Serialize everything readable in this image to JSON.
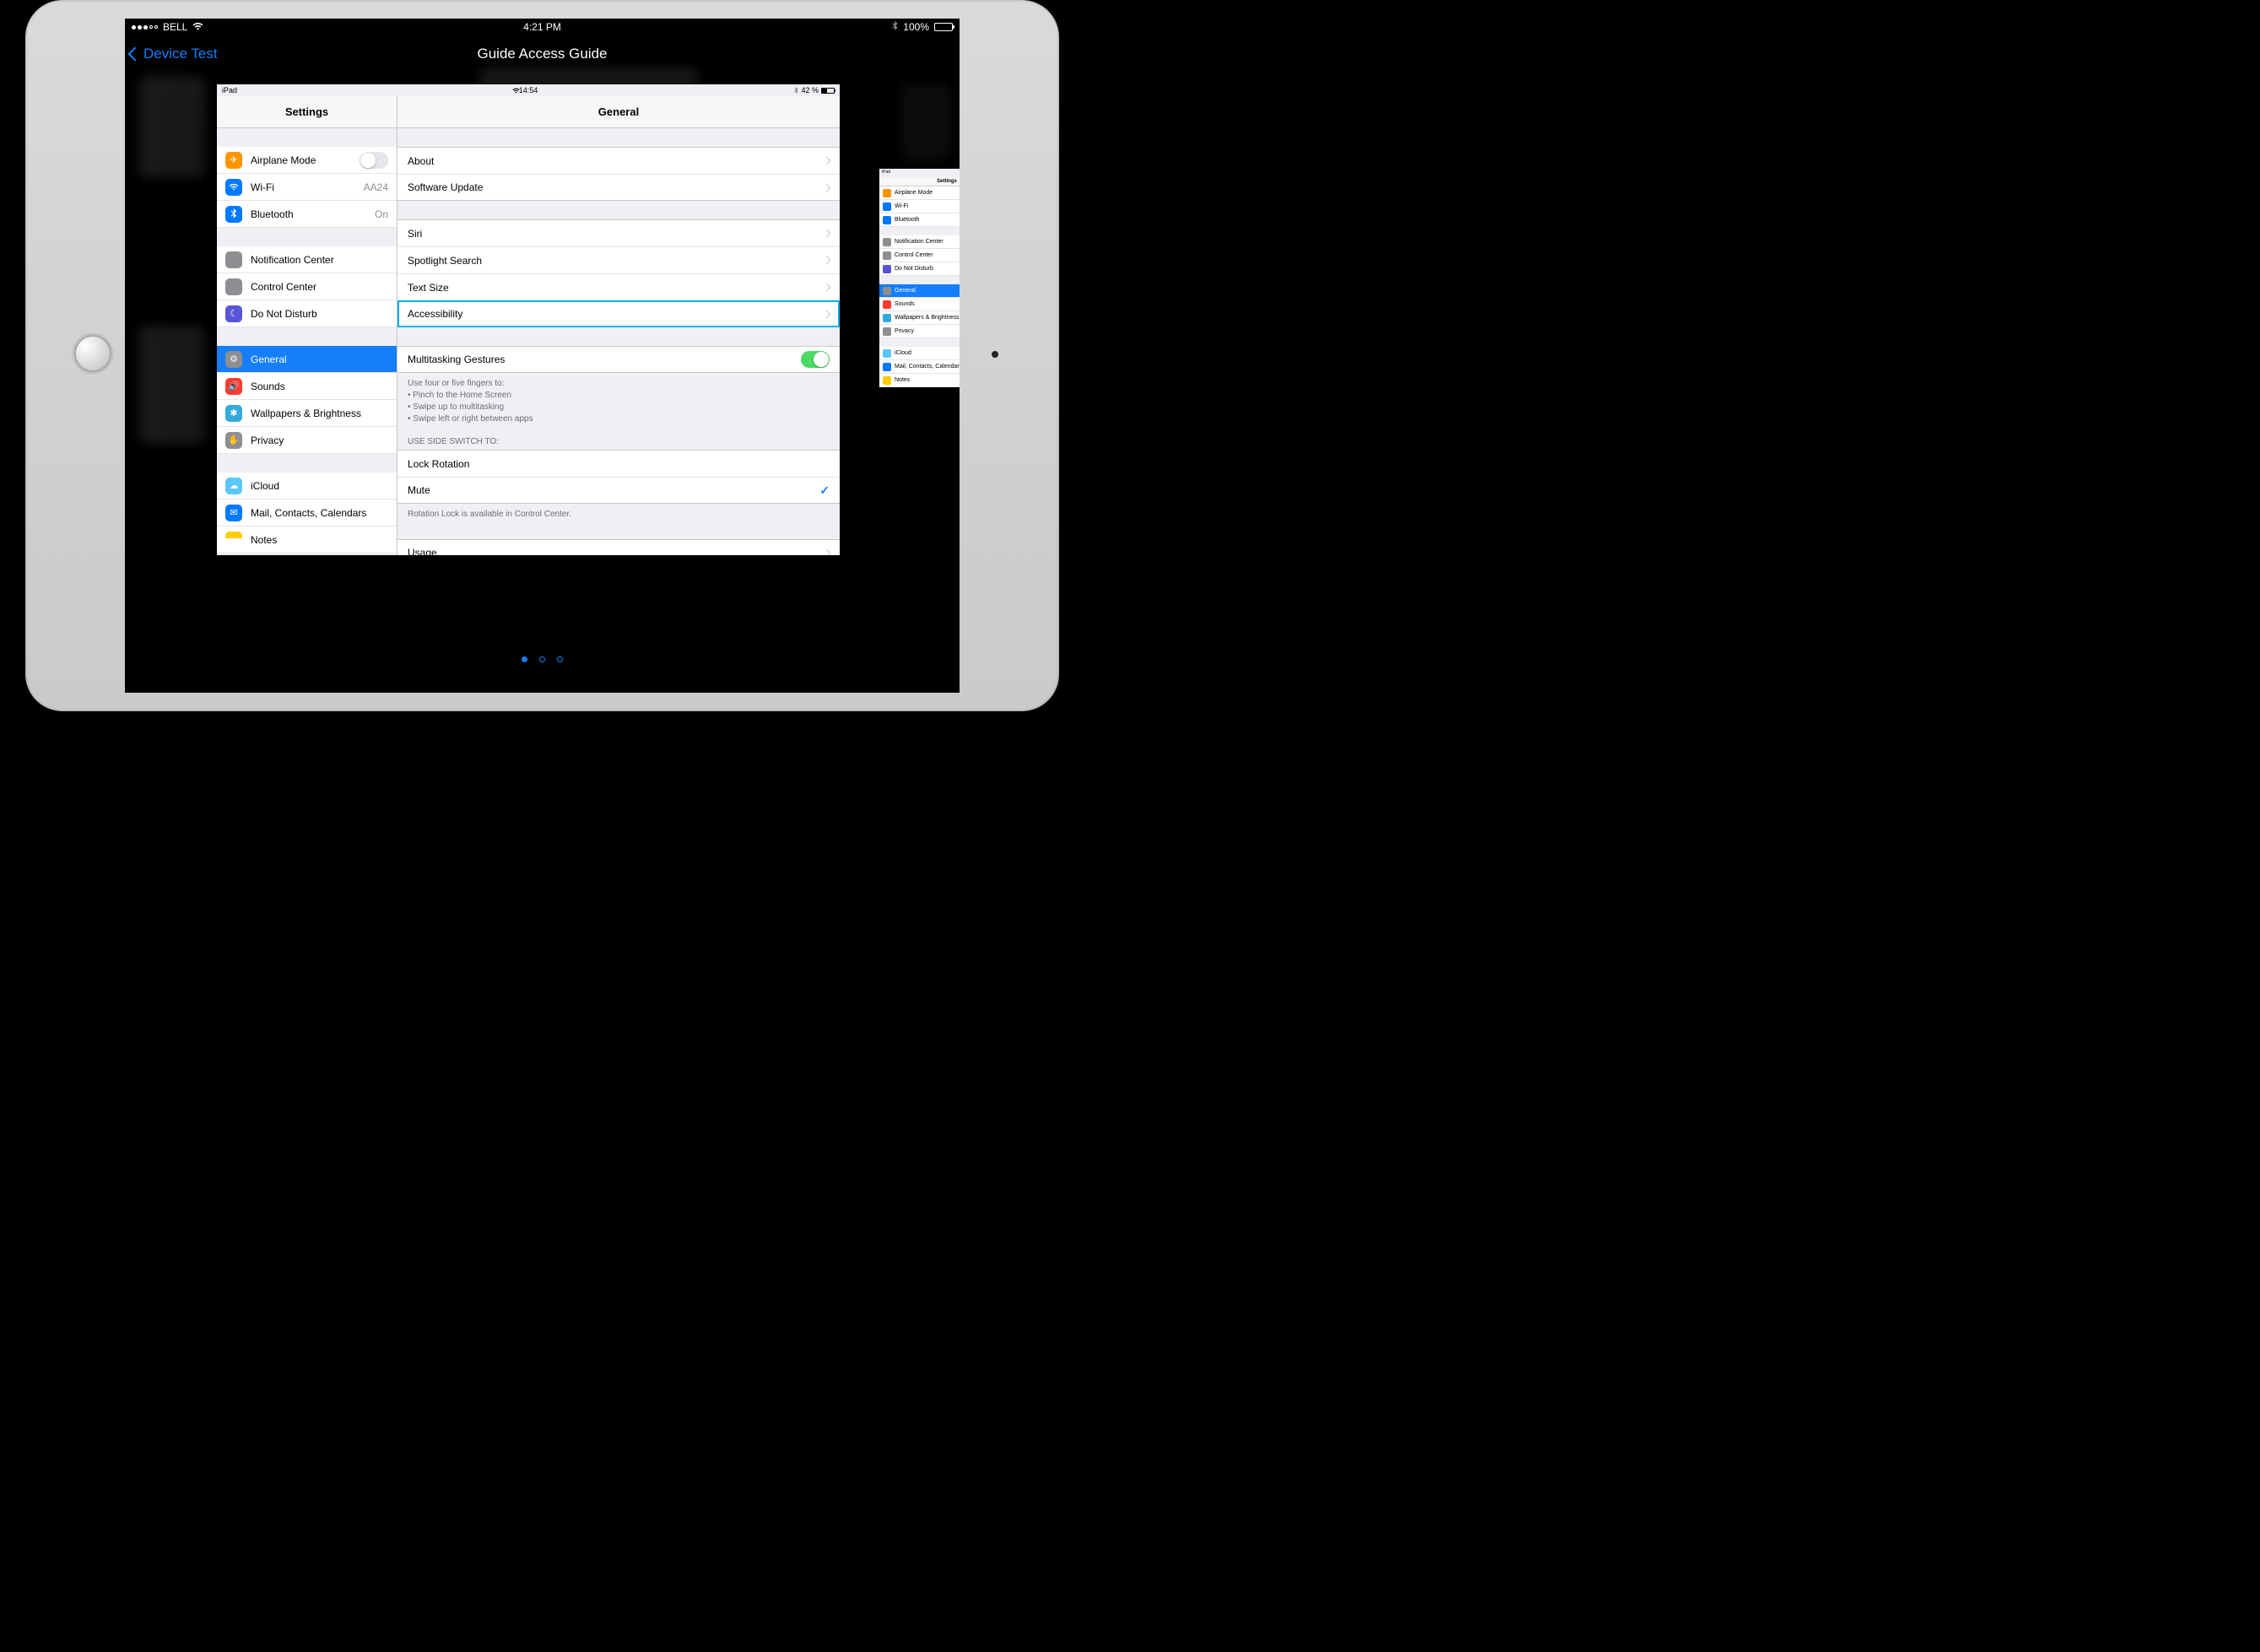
{
  "outer_status": {
    "carrier": "BELL",
    "time": "4:21 PM",
    "battery_pct": "100%"
  },
  "outer_nav": {
    "back_label": "Device Test",
    "title": "Guide Access Guide"
  },
  "pager": {
    "count": 3,
    "active_index": 0
  },
  "settings": {
    "status": {
      "device": "iPad",
      "time": "14:54",
      "battery": "42 %"
    },
    "header": {
      "left": "Settings",
      "right": "General"
    },
    "sidebar": {
      "groups": [
        {
          "items": [
            {
              "icon": "airplane-icon",
              "color": "ic-orange",
              "label": "Airplane Mode",
              "toggle": false
            },
            {
              "icon": "wifi-icon",
              "color": "ic-blue",
              "label": "Wi-Fi",
              "value": "AA24"
            },
            {
              "icon": "bluetooth-icon",
              "color": "ic-blue",
              "label": "Bluetooth",
              "value": "On"
            }
          ]
        },
        {
          "items": [
            {
              "icon": "notification-icon",
              "color": "ic-gray",
              "label": "Notification Center"
            },
            {
              "icon": "control-center-icon",
              "color": "ic-gray",
              "label": "Control Center"
            },
            {
              "icon": "moon-icon",
              "color": "ic-purple",
              "label": "Do Not Disturb"
            }
          ]
        },
        {
          "items": [
            {
              "icon": "gear-icon",
              "color": "ic-gray",
              "label": "General",
              "selected": true
            },
            {
              "icon": "sounds-icon",
              "color": "ic-red",
              "label": "Sounds"
            },
            {
              "icon": "wallpaper-icon",
              "color": "ic-cyan",
              "label": "Wallpapers & Brightness"
            },
            {
              "icon": "privacy-icon",
              "color": "ic-gray",
              "label": "Privacy"
            }
          ]
        },
        {
          "items": [
            {
              "icon": "icloud-icon",
              "color": "ic-lblue",
              "label": "iCloud"
            },
            {
              "icon": "mail-icon",
              "color": "ic-blue",
              "label": "Mail, Contacts, Calendars"
            },
            {
              "icon": "notes-icon",
              "color": "ic-yellow",
              "label": "Notes"
            }
          ]
        }
      ]
    },
    "detail": {
      "group1": [
        {
          "label": "About"
        },
        {
          "label": "Software Update"
        }
      ],
      "group2": [
        {
          "label": "Siri"
        },
        {
          "label": "Spotlight Search"
        },
        {
          "label": "Text Size"
        },
        {
          "label": "Accessibility",
          "highlight": true
        }
      ],
      "gestures": {
        "label": "Multitasking Gestures",
        "on": true,
        "footer_lines": [
          "Use four or five fingers to:",
          "• Pinch to the Home Screen",
          "• Swipe up to multitasking",
          "• Swipe left or right between apps"
        ]
      },
      "side_switch": {
        "header": "USE SIDE SWITCH TO:",
        "options": [
          {
            "label": "Lock Rotation",
            "checked": false
          },
          {
            "label": "Mute",
            "checked": true
          }
        ],
        "footer": "Rotation Lock is available in Control Center."
      },
      "group_last": [
        {
          "label": "Usage"
        }
      ]
    }
  },
  "side_peek": {
    "header": "Settings",
    "rows": [
      {
        "color": "ic-orange",
        "label": "Airplane Mode"
      },
      {
        "color": "ic-blue",
        "label": "Wi-Fi"
      },
      {
        "color": "ic-blue",
        "label": "Bluetooth"
      },
      {
        "gap": true
      },
      {
        "color": "ic-gray",
        "label": "Notification Center"
      },
      {
        "color": "ic-gray",
        "label": "Control Center"
      },
      {
        "color": "ic-purple",
        "label": "Do Not Disturb"
      },
      {
        "gap": true
      },
      {
        "color": "ic-gray",
        "label": "General",
        "selected": true
      },
      {
        "color": "ic-red",
        "label": "Sounds"
      },
      {
        "color": "ic-cyan",
        "label": "Wallpapers & Brightness"
      },
      {
        "color": "ic-gray",
        "label": "Privacy"
      },
      {
        "gap": true
      },
      {
        "color": "ic-lblue",
        "label": "iCloud"
      },
      {
        "color": "ic-blue",
        "label": "Mail, Contacts, Calendars"
      },
      {
        "color": "ic-yellow",
        "label": "Notes"
      }
    ]
  }
}
